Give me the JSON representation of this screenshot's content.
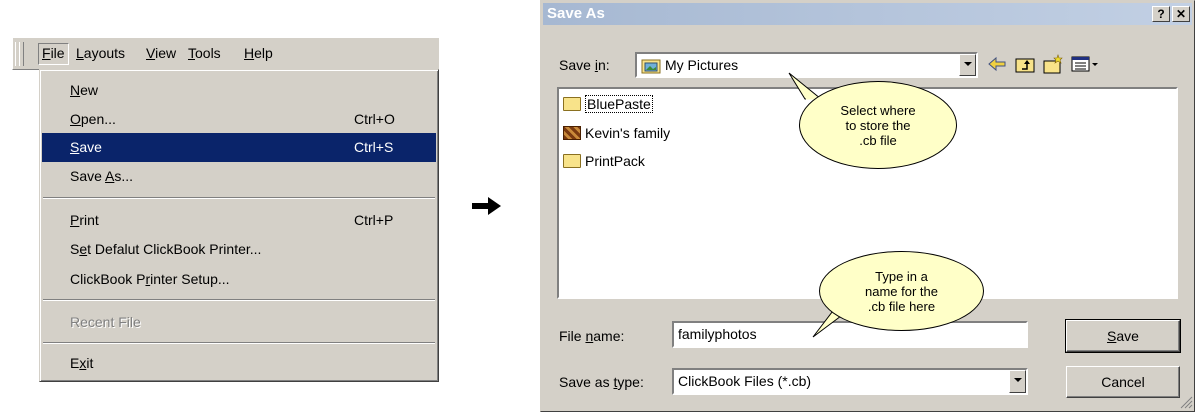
{
  "menu": {
    "bar_items": [
      {
        "label": "File",
        "mnemonic": "F",
        "rest": "ile"
      },
      {
        "label": "Layouts",
        "mnemonic": "L",
        "rest": "ayouts"
      },
      {
        "label": "View",
        "mnemonic": "V",
        "rest": "iew"
      },
      {
        "label": "Tools",
        "mnemonic": "T",
        "rest": "ools"
      },
      {
        "label": "Help",
        "mnemonic": "H",
        "rest": "elp"
      }
    ],
    "items": [
      {
        "pre": "",
        "mn": "N",
        "post": "ew",
        "accel": ""
      },
      {
        "pre": "",
        "mn": "O",
        "post": "pen...",
        "accel": "Ctrl+O"
      },
      {
        "pre": "",
        "mn": "S",
        "post": "ave",
        "accel": "Ctrl+S"
      },
      {
        "pre": "Save ",
        "mn": "A",
        "post": "s...",
        "accel": ""
      },
      {
        "pre": "",
        "mn": "P",
        "post": "rint",
        "accel": "Ctrl+P"
      },
      {
        "pre": "S",
        "mn": "e",
        "post": "t Defalut ClickBook Printer...",
        "accel": ""
      },
      {
        "pre": "ClickBook P",
        "mn": "r",
        "post": "inter Setup...",
        "accel": ""
      },
      {
        "pre": "Recent File",
        "mn": "",
        "post": "",
        "accel": ""
      },
      {
        "pre": "E",
        "mn": "x",
        "post": "it",
        "accel": ""
      }
    ],
    "selected_index": 2
  },
  "arrow": "➡",
  "dialog": {
    "title": "Save As",
    "help_btn": "?",
    "close_btn": "✕",
    "save_in_label": {
      "pre": "Save ",
      "mn": "i",
      "post": "n:"
    },
    "save_in_value": "My Pictures",
    "files": [
      {
        "name": "BluePaste",
        "icon": "folder-icon"
      },
      {
        "name": "Kevin's family",
        "icon": "image-folder-icon"
      },
      {
        "name": "PrintPack",
        "icon": "folder-icon"
      }
    ],
    "file_name_label": {
      "pre": "File ",
      "mn": "n",
      "post": "ame:"
    },
    "file_name_value": "familyphotos",
    "save_type_label": {
      "pre": "Save as ",
      "mn": "t",
      "post": "ype:"
    },
    "save_type_value": "ClickBook Files (*.cb)",
    "save_button": {
      "pre": "",
      "mn": "S",
      "post": "ave"
    },
    "cancel_button": "Cancel",
    "callout_location": "Select where\nto store the\n.cb file",
    "callout_name": "Type in a\nname for the\n.cb file here"
  }
}
